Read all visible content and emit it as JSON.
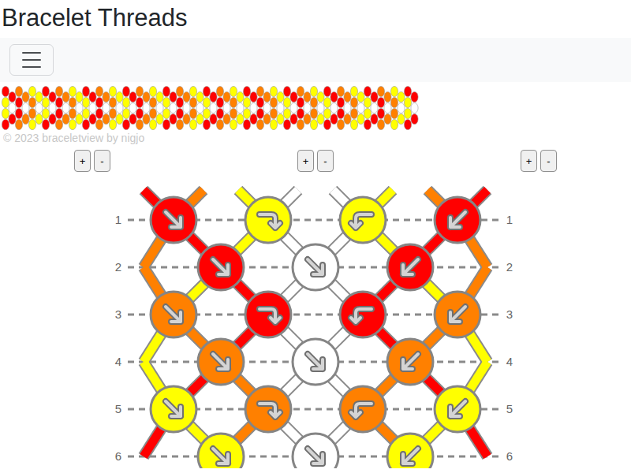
{
  "title": "Bracelet Threads",
  "copyright": "© 2023 braceletview by nigjo",
  "controls": [
    {
      "plus": "+",
      "minus": "-"
    },
    {
      "plus": "+",
      "minus": "-"
    },
    {
      "plus": "+",
      "minus": "-"
    }
  ],
  "threads": [
    {
      "color": "#ff0000"
    },
    {
      "color": "#ff8000"
    },
    {
      "color": "#ffff00"
    },
    {
      "color": "#ffffff"
    },
    {
      "color": "#ffffff"
    },
    {
      "color": "#ffff00"
    },
    {
      "color": "#ff8000"
    },
    {
      "color": "#ff0000"
    }
  ],
  "rows": [
    {
      "label": "1",
      "knots": [
        "f",
        "fb",
        "bf",
        "b"
      ]
    },
    {
      "label": "2",
      "knots": [
        "f",
        "f",
        "b"
      ]
    },
    {
      "label": "3",
      "knots": [
        "f",
        "fb",
        "bf",
        "b"
      ]
    },
    {
      "label": "4",
      "knots": [
        "f",
        "f",
        "b"
      ]
    },
    {
      "label": "5",
      "knots": [
        "f",
        "fb",
        "bf",
        "b"
      ]
    },
    {
      "label": "6",
      "knots": [
        "f",
        "f",
        "b"
      ]
    }
  ]
}
